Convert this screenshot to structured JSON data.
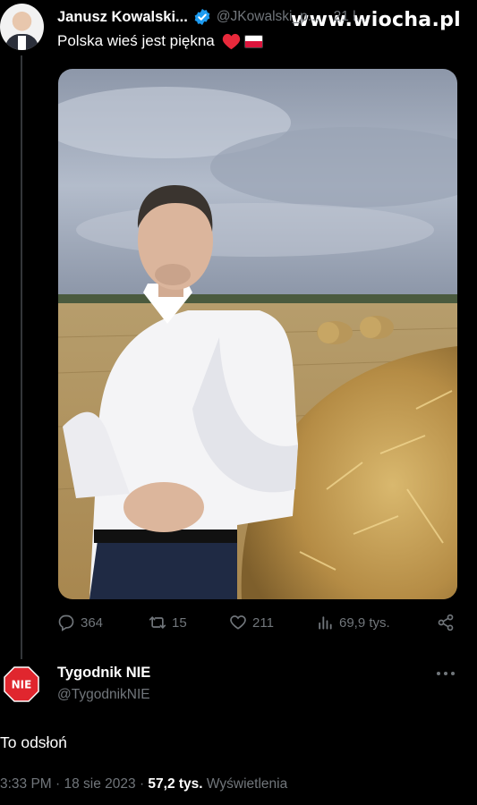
{
  "watermark": "www.wiocha.pl",
  "tweet": {
    "author_name": "Janusz Kowalski...",
    "handle": "@JKowalski_p...",
    "time": "21 l...",
    "text": "Polska wieś jest piękna",
    "emoji": [
      "red-heart",
      "poland-flag"
    ],
    "stats": {
      "replies": "364",
      "retweets": "15",
      "likes": "211",
      "views": "69,9 tys."
    }
  },
  "reply": {
    "author_name": "Tygodnik NIE",
    "handle": "@TygodnikNIE",
    "avatar_text": "NIE",
    "text": "To odsłoń",
    "meta_prefix": "3:33 PM · 18 sie 2023 · ",
    "views_count": "57,2 tys.",
    "views_label": " Wyświetlenia"
  },
  "colors": {
    "background": "#000000",
    "secondary_text": "#71767b",
    "verified_blue": "#1d9bf0",
    "nie_red": "#e0262e"
  }
}
